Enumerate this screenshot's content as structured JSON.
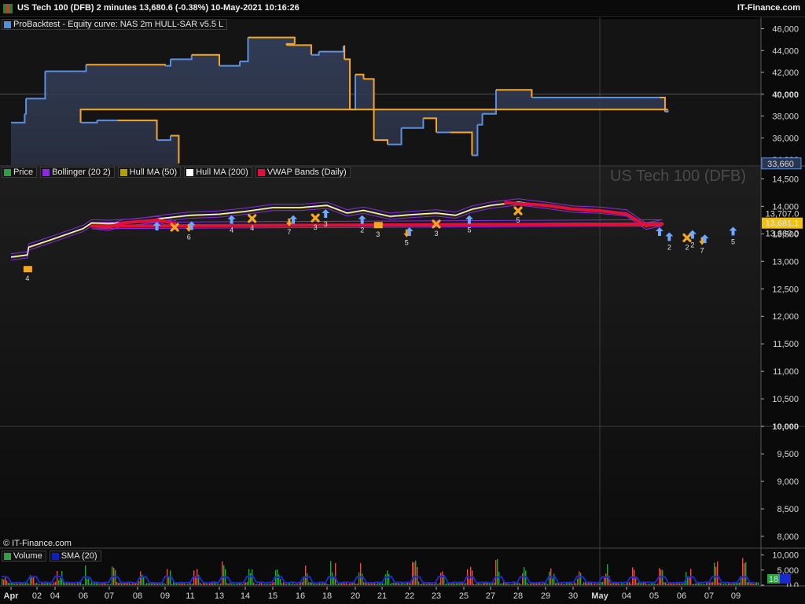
{
  "window": {
    "title": "US Tech 100 (DFB) 2 minutes 13,680.6 (-0.38%) 10-May-2021 10:16:26",
    "brand": "IT-Finance.com",
    "credit": "© IT-Finance.com"
  },
  "equity_panel": {
    "legend": [
      {
        "label": "ProBacktest - Equity curve: NAS 2m HULL-SAR v5.5 L",
        "color": "#4f8fe0"
      }
    ],
    "axis_ticks": [
      "46,000",
      "44,000",
      "42,000",
      "40,000",
      "38,000",
      "36,000",
      "34,000"
    ],
    "last_value": "33,660"
  },
  "price_panel": {
    "legend": [
      {
        "label": "Price",
        "color": "#2ea043"
      },
      {
        "label": "Bollinger (20 2)",
        "color": "#8a2be2"
      },
      {
        "label": "Hull MA (50)",
        "color": "#b5a000"
      },
      {
        "label": "Hull MA (200)",
        "color": "#ffffff"
      },
      {
        "label": "VWAP Bands (Daily)",
        "color": "#e0103a"
      }
    ],
    "watermark": "US Tech 100 (DFB)",
    "axis_ticks": [
      "14,500",
      "14,000",
      "13,500",
      "13,000",
      "12,500",
      "12,000",
      "11,500",
      "11,000",
      "10,500",
      "10,000",
      "9,500",
      "9,000",
      "8,500",
      "8,000"
    ],
    "price_tag": "13,681.1",
    "price_tag_hidden": "13,707.0",
    "price_sub_label": "13,660.0"
  },
  "volume_panel": {
    "legend": [
      {
        "label": "Volume",
        "color": "#2ea043"
      },
      {
        "label": "SMA (20)",
        "color": "#1020c0"
      }
    ],
    "axis_ticks": [
      "10,000",
      "5,000",
      "0.0"
    ],
    "value_tag": "18"
  },
  "date_axis": {
    "labels": [
      "Apr",
      "02",
      "04",
      "06",
      "07",
      "08",
      "09",
      "11",
      "13",
      "14",
      "15",
      "16",
      "18",
      "20",
      "21",
      "22",
      "23",
      "25",
      "27",
      "28",
      "29",
      "30",
      "May",
      "04",
      "05",
      "06",
      "07",
      "09"
    ],
    "bold_labels": [
      "Apr",
      "May"
    ]
  },
  "markers": [
    {
      "type": "square",
      "color": "#f5a623",
      "value": 13030,
      "date": "Apr",
      "offset": 0.6,
      "label": "4"
    },
    {
      "type": "up",
      "color": "#6fa8ff",
      "value": 13600,
      "date": "06",
      "offset": -0.45,
      "label": "2"
    },
    {
      "type": "x",
      "color": "#f5a623",
      "value": 13600,
      "date": "06",
      "offset": 0.2,
      "label": "2"
    },
    {
      "type": "x",
      "color": "#f5a623",
      "value": 13790,
      "date": "09",
      "offset": 0.35,
      "label": ""
    },
    {
      "type": "up",
      "color": "#6fa8ff",
      "value": 13790,
      "date": "09",
      "offset": -0.3,
      "label": ""
    },
    {
      "type": "down",
      "color": "#f5a623",
      "value": 13780,
      "date": "11",
      "offset": -0.05,
      "label": "6"
    },
    {
      "type": "up",
      "color": "#6fa8ff",
      "value": 13800,
      "date": "11",
      "offset": 0.05,
      "label": ""
    },
    {
      "type": "up",
      "color": "#6fa8ff",
      "value": 13910,
      "date": "14",
      "offset": -0.5,
      "label": "4"
    },
    {
      "type": "x",
      "color": "#f5a623",
      "value": 13950,
      "date": "14",
      "offset": 0.25,
      "label": "4"
    },
    {
      "type": "down",
      "color": "#f5a623",
      "value": 13880,
      "date": "15",
      "offset": 0.6,
      "label": "7"
    },
    {
      "type": "up",
      "color": "#6fa8ff",
      "value": 13910,
      "date": "15",
      "offset": 0.75,
      "label": ""
    },
    {
      "type": "x",
      "color": "#f5a623",
      "value": 13960,
      "date": "16",
      "offset": 0.55,
      "label": "3"
    },
    {
      "type": "up",
      "color": "#6fa8ff",
      "value": 14020,
      "date": "18",
      "offset": -0.05,
      "label": "3"
    },
    {
      "type": "up",
      "color": "#6fa8ff",
      "value": 13910,
      "date": "20",
      "offset": 0.25,
      "label": "2"
    },
    {
      "type": "square",
      "color": "#f5a623",
      "value": 13830,
      "date": "21",
      "offset": -0.15,
      "label": "3"
    },
    {
      "type": "down",
      "color": "#f5a623",
      "value": 13680,
      "date": "21",
      "offset": 0.9,
      "label": "5"
    },
    {
      "type": "up",
      "color": "#6fa8ff",
      "value": 13690,
      "date": "21",
      "offset": 1.0,
      "label": ""
    },
    {
      "type": "x",
      "color": "#f5a623",
      "value": 13850,
      "date": "23",
      "offset": 0.0,
      "label": "3"
    },
    {
      "type": "up",
      "color": "#6fa8ff",
      "value": 13910,
      "date": "25",
      "offset": 0.2,
      "label": "5"
    },
    {
      "type": "x",
      "color": "#f5a623",
      "value": 14090,
      "date": "28",
      "offset": 0.0,
      "label": "5"
    },
    {
      "type": "up",
      "color": "#6fa8ff",
      "value": 13690,
      "date": "05",
      "offset": 0.2,
      "label": ""
    },
    {
      "type": "up",
      "color": "#6fa8ff",
      "value": 13640,
      "date": "06",
      "offset": 0.4,
      "label": "2"
    },
    {
      "type": "down",
      "color": "#f5a623",
      "value": 13540,
      "date": "06",
      "offset": 0.75,
      "label": "7"
    },
    {
      "type": "up",
      "color": "#6fa8ff",
      "value": 13560,
      "date": "06",
      "offset": 0.85,
      "label": ""
    },
    {
      "type": "up",
      "color": "#6fa8ff",
      "value": 13700,
      "date": "09",
      "offset": -0.1,
      "label": "5"
    }
  ],
  "chart_data": [
    {
      "type": "line",
      "name": "ProBacktest - Equity curve: NAS 2m HULL-SAR v5.5 L",
      "ylim": [
        33500,
        46900
      ],
      "x_dates": [
        "Apr",
        "Apr",
        "02",
        "02",
        "04",
        "06",
        "06",
        "09",
        "09",
        "11",
        "11",
        "13",
        "14",
        "14",
        "15",
        "16",
        "16",
        "18",
        "18",
        "20",
        "20",
        "20",
        "20",
        "21",
        "21",
        "22",
        "22",
        "23",
        "25",
        "25",
        "25",
        "27",
        "27",
        "28",
        "30",
        "May",
        "04",
        "05",
        "05",
        "05",
        "06",
        "06",
        "07",
        "07",
        "09",
        "09",
        "09"
      ],
      "x_offsets": [
        0,
        0.5,
        -0.4,
        0.3,
        0,
        -0.2,
        0.1,
        0,
        0.2,
        -0.1,
        0.05,
        0,
        -0.2,
        0.1,
        0.8,
        -0.5,
        0.4,
        -0.3,
        0.6,
        -0.4,
        -0.2,
        0,
        0.3,
        -0.3,
        0.2,
        -0.3,
        0.5,
        0,
        -0.5,
        0.3,
        0.5,
        -0.3,
        0.2,
        0.5,
        0,
        0,
        0,
        0.2,
        0.4,
        0.5,
        -0.1,
        0.5,
        -0.3,
        0.3,
        -0.3,
        0.2,
        0.5
      ],
      "values": [
        37400,
        38200,
        39600,
        42100,
        42100,
        42100,
        42700,
        42600,
        43200,
        43200,
        43600,
        42600,
        43000,
        45200,
        44600,
        44500,
        43600,
        43900,
        44400,
        43200,
        38600,
        41800,
        41400,
        35800,
        35400,
        36900,
        37800,
        36500,
        36500,
        34400,
        37200,
        38200,
        40400,
        39700,
        39700,
        39700,
        39700,
        39700,
        38400,
        38600,
        37400,
        37600,
        37600,
        37600,
        35800,
        36200,
        33660
      ]
    },
    {
      "type": "line",
      "name": "Price",
      "ylim": [
        7800,
        14720
      ],
      "x_dates": [
        "Apr",
        "Apr",
        "02",
        "02",
        "04",
        "06",
        "06",
        "07",
        "08",
        "09",
        "11",
        "13",
        "14",
        "15",
        "16",
        "18",
        "20",
        "20",
        "21",
        "22",
        "23",
        "25",
        "25",
        "27",
        "28",
        "29",
        "30",
        "May",
        "04",
        "05",
        "05",
        "06",
        "07",
        "07",
        "09",
        "09"
      ],
      "x_offsets": [
        0,
        0.6,
        -0.3,
        0.3,
        0,
        0,
        0.3,
        0,
        0,
        0,
        0,
        0,
        0,
        0,
        0,
        0,
        -0.3,
        0.3,
        0.3,
        0,
        0,
        -0.3,
        0.3,
        0,
        0,
        0,
        0,
        0,
        0,
        -0.3,
        0.3,
        0.3,
        0,
        0.5,
        -0.3,
        0.4
      ],
      "values": [
        13080,
        13120,
        13260,
        13360,
        13420,
        13600,
        13700,
        13690,
        13720,
        13790,
        13840,
        13860,
        13910,
        13980,
        13980,
        14020,
        13880,
        13930,
        13820,
        13850,
        13880,
        13840,
        13950,
        14020,
        14080,
        14020,
        13950,
        13930,
        13880,
        13640,
        13700,
        13650,
        13620,
        13700,
        13760,
        13680
      ]
    },
    {
      "type": "line",
      "name": "VWAP Bands (Daily)",
      "ylim": [
        7800,
        14720
      ],
      "x_dates": [
        "27",
        "28",
        "29",
        "30",
        "May",
        "04",
        "05",
        "05",
        "06",
        "07",
        "07",
        "09",
        "09"
      ],
      "x_offsets": [
        0.5,
        0,
        0,
        0,
        0,
        0,
        -0.3,
        0.3,
        0.3,
        0,
        0.5,
        -0.3,
        0.4
      ],
      "values": [
        14070,
        14050,
        14020,
        13950,
        13920,
        13860,
        13650,
        13680,
        13640,
        13620,
        13700,
        13750,
        13690
      ]
    },
    {
      "type": "bar",
      "name": "Volume",
      "ylim": [
        0,
        12000
      ],
      "peak_values": [
        3200,
        6500,
        5800,
        7400,
        8800,
        4600,
        9000,
        6800,
        11000,
        7500,
        6200,
        7000,
        10800,
        7800,
        9600,
        8300,
        7200,
        6400,
        10000,
        9100,
        8700,
        5000,
        7600,
        6300,
        8400,
        6900,
        10100,
        9200
      ]
    }
  ]
}
